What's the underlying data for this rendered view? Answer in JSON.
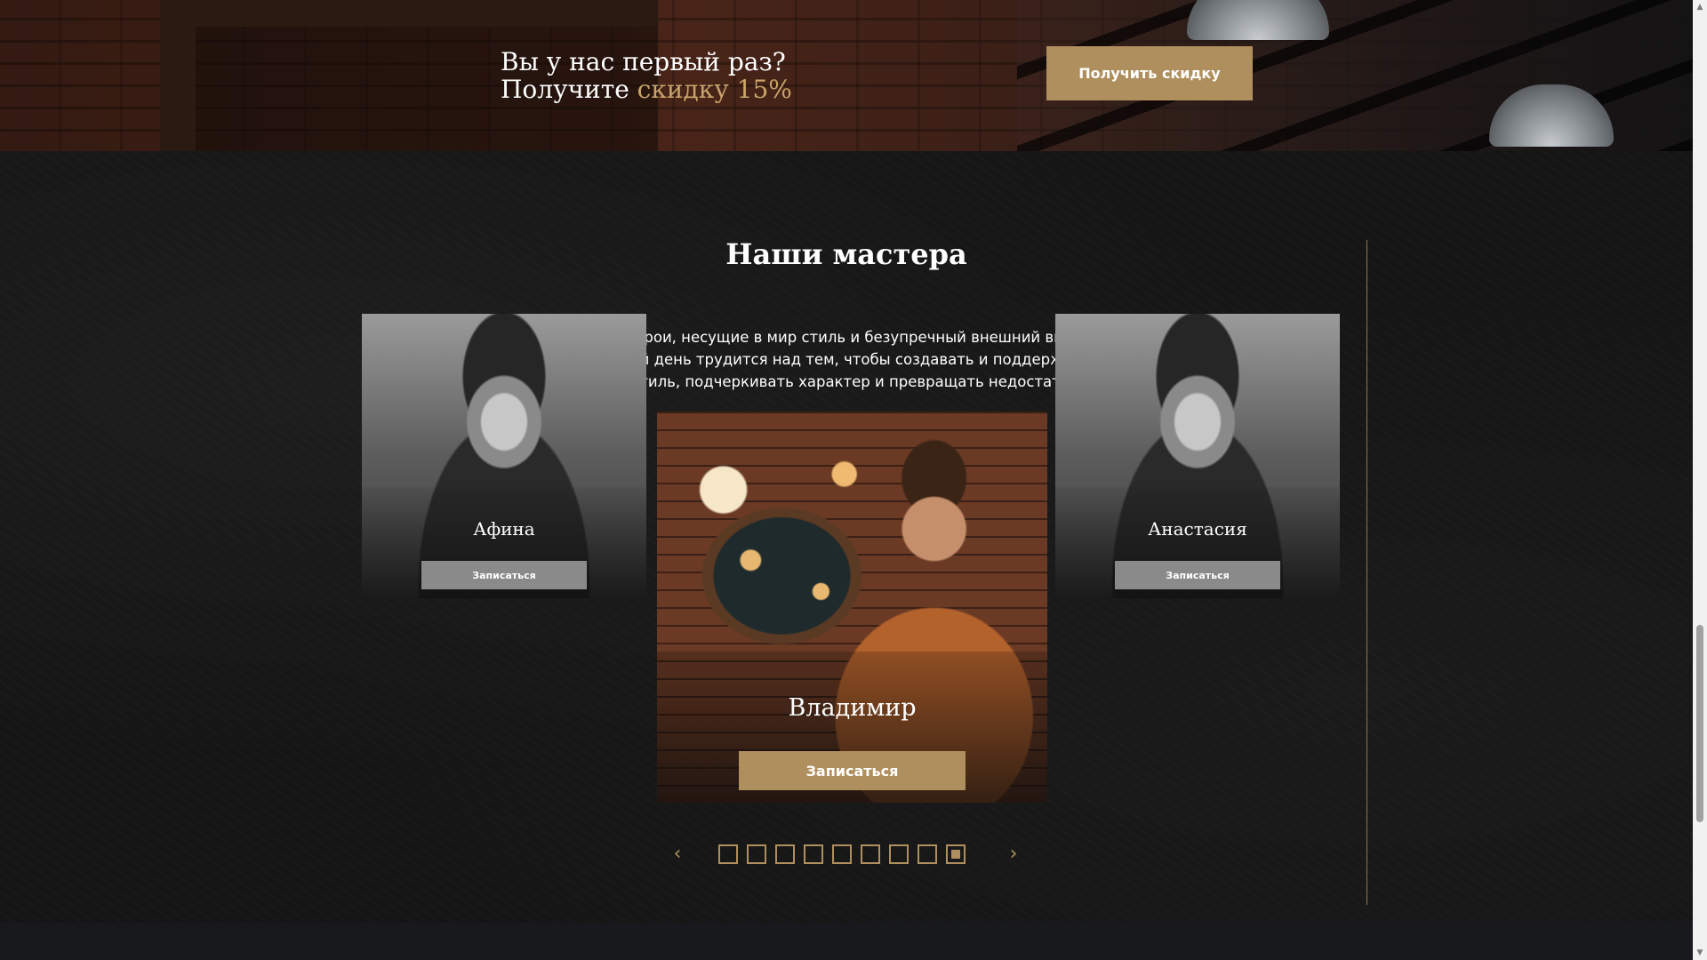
{
  "promo": {
    "line1": "Вы у нас первый раз?",
    "line2_prefix": "Получите ",
    "line2_accent": "скидку 15%",
    "button_label": "Получить скидку"
  },
  "masters": {
    "title": "Наши мастера",
    "description": "Вот они, простые герои, несущие в мир стиль и безупречный внешний вид. Команда Barber Club каждый день трудится над тем, чтобы создавать и поддерживать ваш индивидуальный стиль, подчеркивать характер и превращать недостатки в достоинства.",
    "cards": [
      {
        "name": "Афина",
        "button_label": "Записаться"
      },
      {
        "name": "Владимир",
        "button_label": "Записаться"
      },
      {
        "name": "Анастасия",
        "button_label": "Записаться"
      }
    ],
    "pager": {
      "prev_icon": "‹",
      "next_icon": "›",
      "dot_count": 9,
      "active_index": 8
    }
  },
  "icons": {
    "scroll_up": "▲",
    "scroll_down": "▼"
  },
  "colors": {
    "accent": "#b08f5e",
    "accent_text": "#c9a46a",
    "background": "#151515",
    "side_button": "#8a8a8a"
  }
}
